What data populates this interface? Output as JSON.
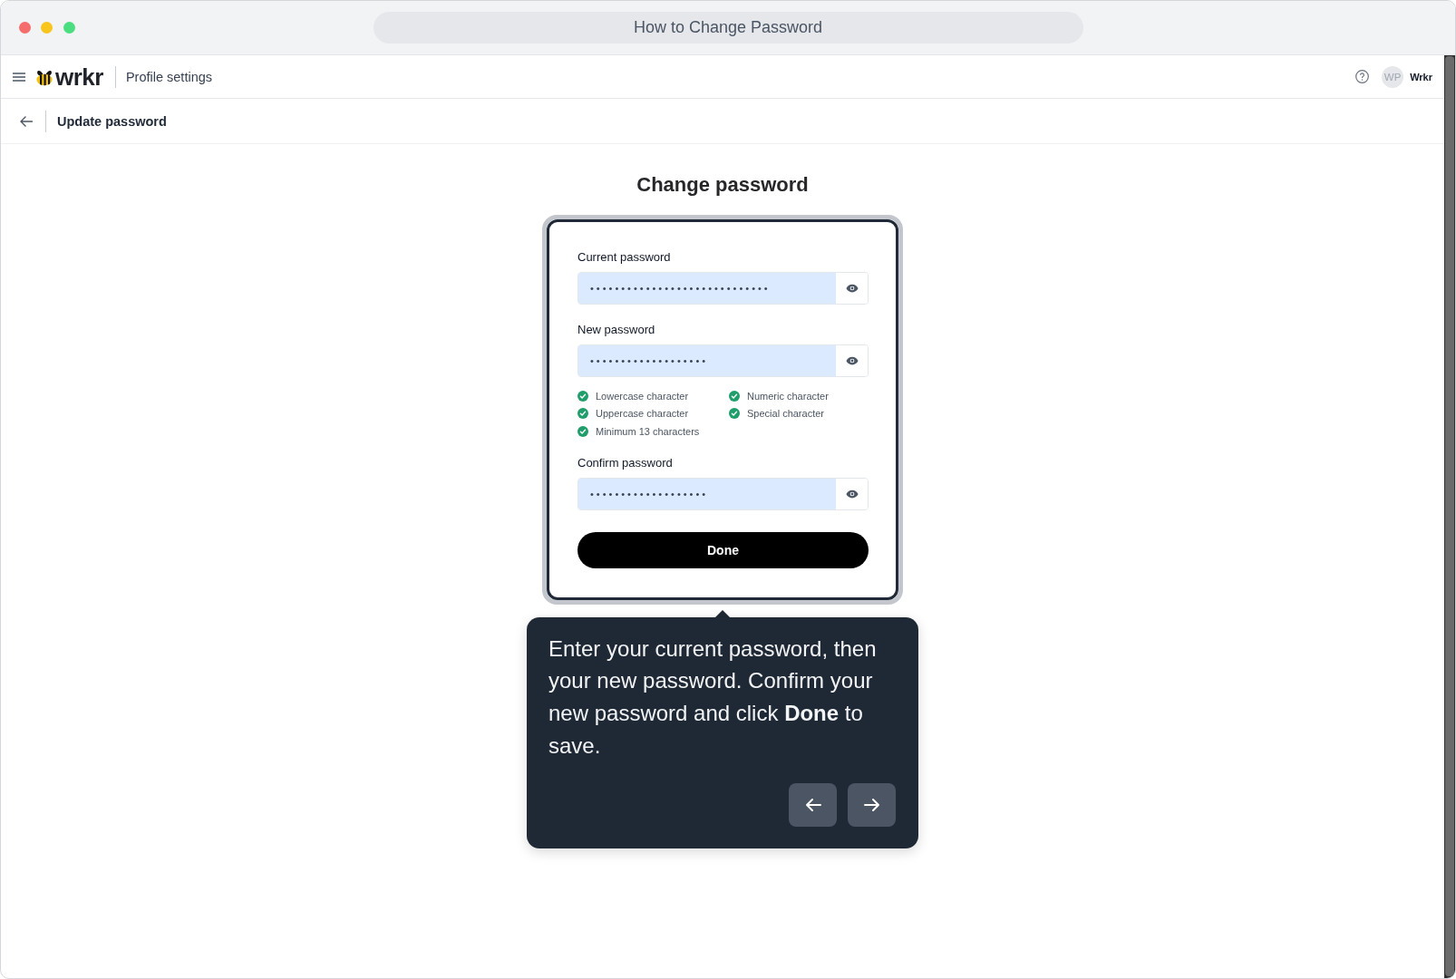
{
  "window": {
    "title": "How to Change Password"
  },
  "header": {
    "logo": "wrkr",
    "section": "Profile settings",
    "avatar": "WP",
    "user": "Wrkr"
  },
  "subheader": {
    "title": "Update password"
  },
  "form": {
    "title": "Change password",
    "fields": [
      {
        "label": "Current password",
        "value": "•••••••••••••••••••••••••••••"
      },
      {
        "label": "New password",
        "value": "•••••••••••••••••••",
        "requirements": [
          {
            "label": "Lowercase character",
            "met": true
          },
          {
            "label": "Numeric character",
            "met": true
          },
          {
            "label": "Uppercase character",
            "met": true
          },
          {
            "label": "Special character",
            "met": true
          },
          {
            "label": "Minimum 13 characters",
            "met": true
          }
        ]
      },
      {
        "label": "Confirm password",
        "value": "•••••••••••••••••••"
      }
    ],
    "submit": "Done"
  },
  "tooltip": {
    "text": "Enter your current password, then your new password. Confirm your new password and click **Done** to save."
  }
}
